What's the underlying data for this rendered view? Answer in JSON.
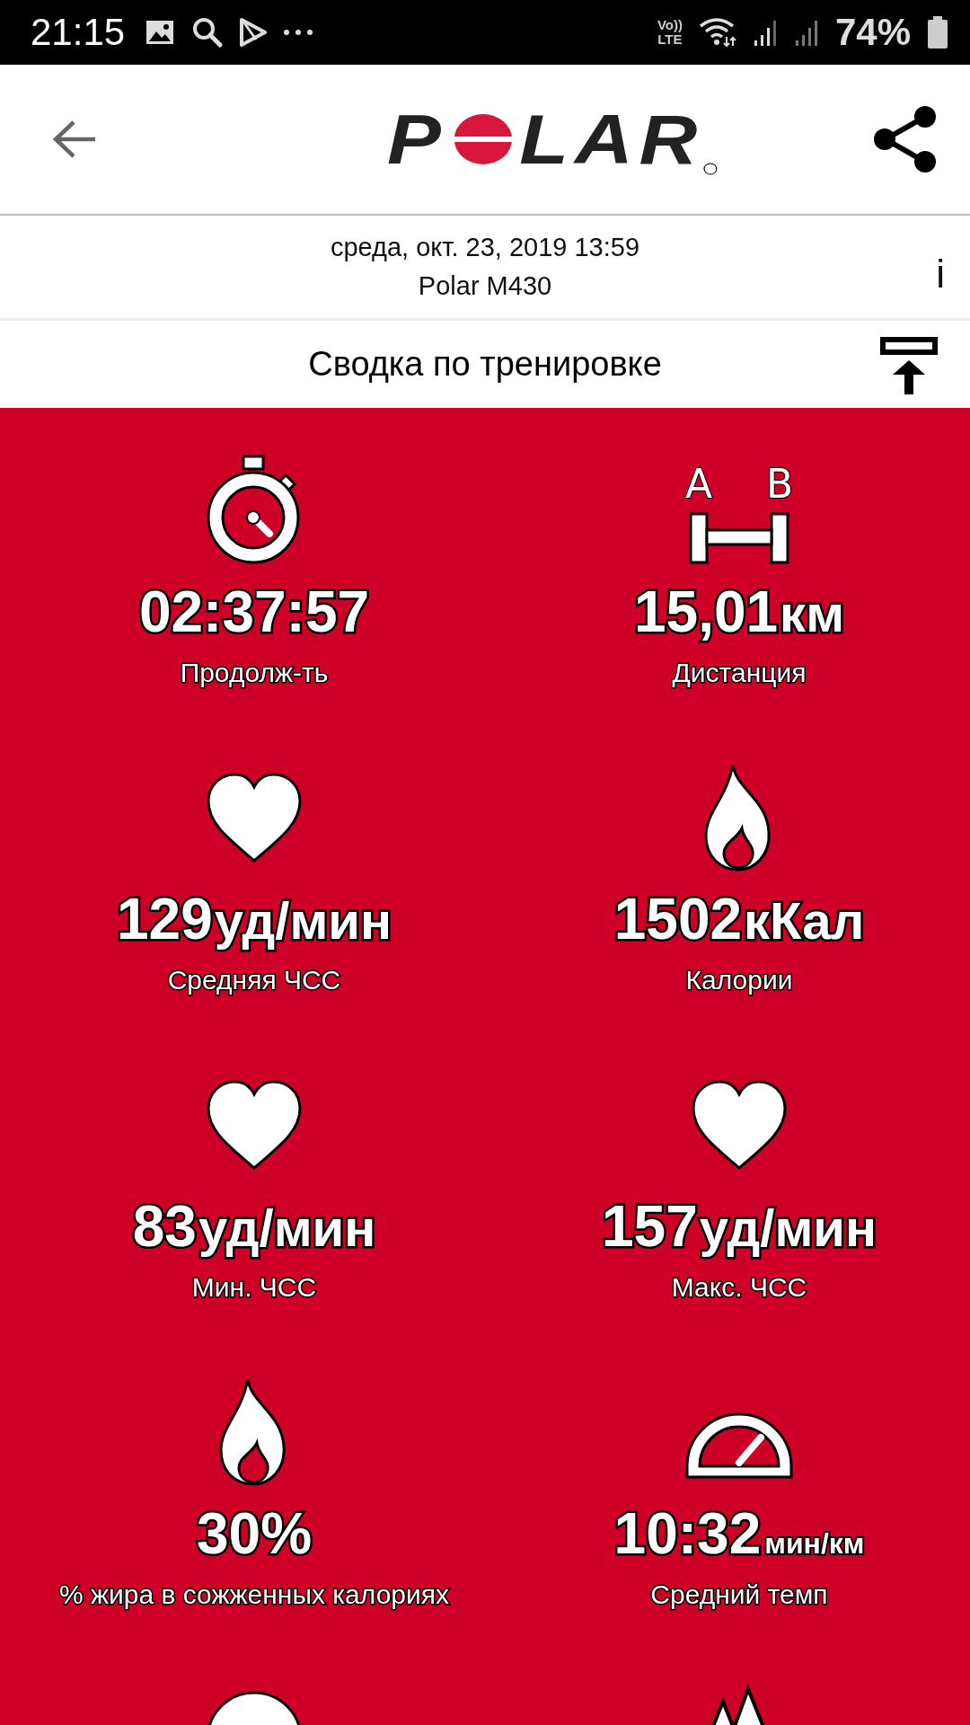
{
  "status_bar": {
    "time": "21:15",
    "volte": "Vo))",
    "lte": "LTE",
    "battery": "74%"
  },
  "header": {
    "logo_start": "P",
    "logo_end": "LAR"
  },
  "info": {
    "date": "среда, окт. 23, 2019 13:59",
    "device": "Polar M430",
    "info_button": "i"
  },
  "section": {
    "title": "Сводка по тренировке"
  },
  "distance_icon_markers": {
    "start": "A",
    "end": "B"
  },
  "stats": [
    {
      "kind": "duration",
      "value": "02:37:57",
      "label": "Продолж-ть"
    },
    {
      "kind": "distance",
      "value": "15,01",
      "unit": "км",
      "label": "Дистанция"
    },
    {
      "kind": "heart",
      "value": "129",
      "unit": "уд/мин",
      "label": "Средняя ЧСС"
    },
    {
      "kind": "calories",
      "value": "1502",
      "unit": "кКал",
      "label": "Калории"
    },
    {
      "kind": "heart",
      "value": "83",
      "unit": "уд/мин",
      "label": "Мин. ЧСС"
    },
    {
      "kind": "heart",
      "value": "157",
      "unit": "уд/мин",
      "label": "Макс. ЧСС"
    },
    {
      "kind": "calories",
      "value": "30%",
      "label": "% жира в сожженных калориях"
    },
    {
      "kind": "pace",
      "value": "10:32",
      "unit": "мин/км",
      "label": "Средний темп"
    },
    {
      "kind": "round"
    },
    {
      "kind": "mountain"
    }
  ]
}
